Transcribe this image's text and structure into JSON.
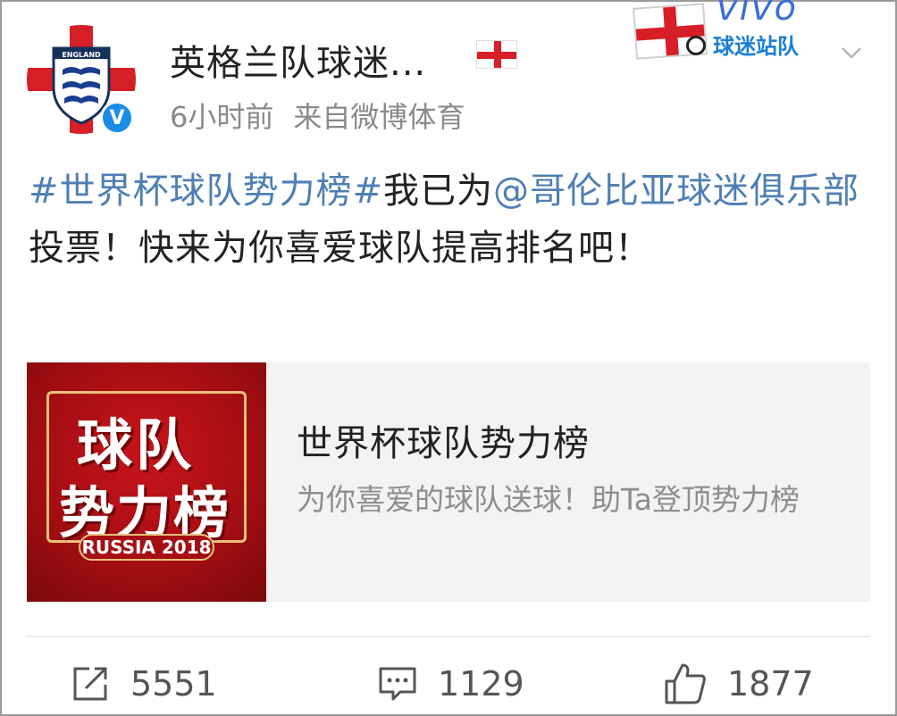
{
  "header": {
    "avatar_text": "ENGLAND",
    "verified_mark": "V",
    "username": "英格兰队球迷...",
    "time_ago": "6小时前",
    "source": "来自微博体育",
    "badge": {
      "brand": "vivo",
      "team_label": "球迷站队"
    }
  },
  "post": {
    "hashtag": "#世界杯球队势力榜#",
    "text_1": "我已为",
    "mention": "@哥伦比亚球迷俱乐部",
    "text_2": " 投票！快来为你喜爱球队提高排名吧！"
  },
  "card": {
    "image_line1": "球队",
    "image_line2": "势力榜",
    "image_tag": "RUSSIA 2018",
    "title": "世界杯球队势力榜",
    "description": "为你喜爱的球队送球！助Ta登顶势力榜"
  },
  "actions": {
    "share_count": "5551",
    "comment_count": "1129",
    "like_count": "1877"
  },
  "icons": {
    "share": "share-icon",
    "comment": "comment-icon",
    "like": "thumbs-up-icon",
    "chevron": "chevron-down-icon"
  },
  "colors": {
    "link": "#4e7fb4",
    "meta": "#8a8a8a",
    "verified": "#1a8ee6",
    "flag_red": "#d61f26",
    "card_bg": "#f3f3f3"
  }
}
